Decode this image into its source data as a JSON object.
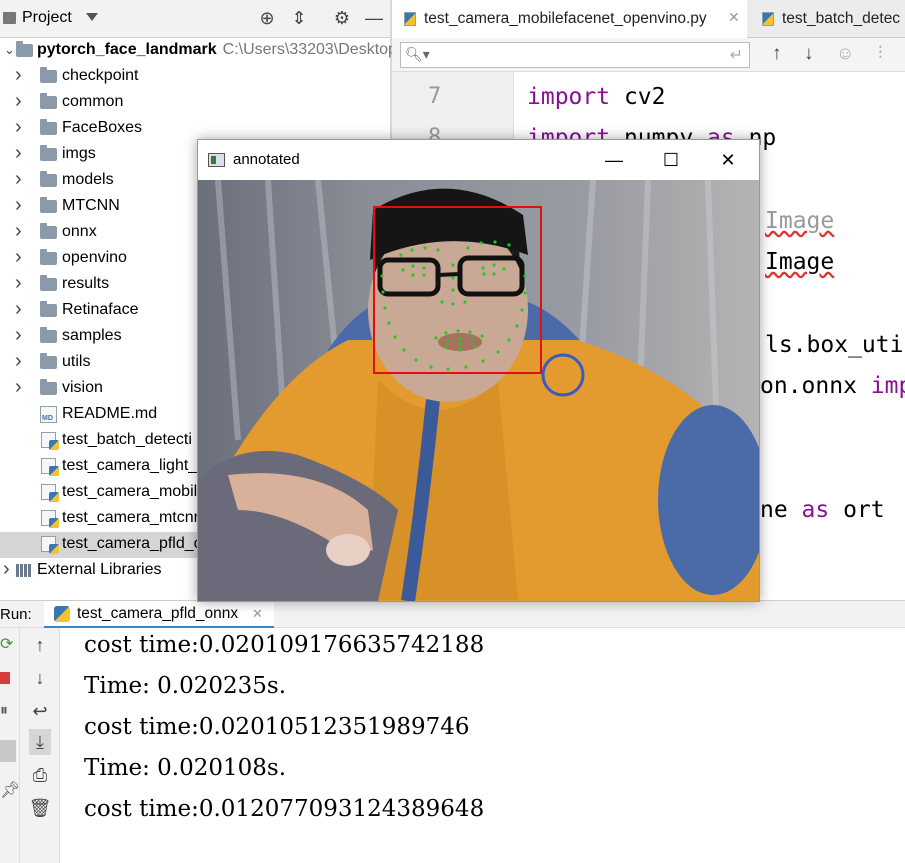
{
  "project": {
    "title": "Project",
    "root_name": "pytorch_face_landmark",
    "root_path": "C:\\Users\\33203\\Desktop",
    "items": [
      {
        "label": "checkpoint",
        "type": "folder"
      },
      {
        "label": "common",
        "type": "folder"
      },
      {
        "label": "FaceBoxes",
        "type": "folder"
      },
      {
        "label": "imgs",
        "type": "folder"
      },
      {
        "label": "models",
        "type": "folder"
      },
      {
        "label": "MTCNN",
        "type": "folder"
      },
      {
        "label": "onnx",
        "type": "folder"
      },
      {
        "label": "openvino",
        "type": "folder"
      },
      {
        "label": "results",
        "type": "folder"
      },
      {
        "label": "Retinaface",
        "type": "folder"
      },
      {
        "label": "samples",
        "type": "folder"
      },
      {
        "label": "utils",
        "type": "folder"
      },
      {
        "label": "vision",
        "type": "folder"
      },
      {
        "label": "README.md",
        "type": "md"
      },
      {
        "label": "test_batch_detecti",
        "type": "py"
      },
      {
        "label": "test_camera_light_",
        "type": "py"
      },
      {
        "label": "test_camera_mobil",
        "type": "py"
      },
      {
        "label": "test_camera_mtcnr",
        "type": "py"
      },
      {
        "label": "test_camera_pfld_c",
        "type": "py",
        "selected": true
      }
    ],
    "external_libraries": "External Libraries",
    "md_badge": "MD"
  },
  "editor": {
    "tabs": [
      {
        "label": "test_camera_mobilefacenet_openvino.py",
        "active": true
      },
      {
        "label": "test_batch_detec",
        "active": false
      }
    ],
    "line_numbers": [
      "7",
      "8"
    ],
    "code": {
      "l7_kw": "import",
      "l7_rest": " cv2",
      "l8_kw": "import",
      "l8_mid": " numpy ",
      "l8_kw2": "as",
      "l8_rest": " np",
      "l_image1": "Image",
      "l_image2": "Image",
      "l_box": "ls.box_uti",
      "l_onnx": "on.onnx ",
      "l_onnx_kw": "imp",
      "l_ort_pre": "ne ",
      "l_ort_kw": "as",
      "l_ort_rest": " ort"
    }
  },
  "window": {
    "title": "annotated",
    "minimize": "—",
    "maximize": "☐",
    "close": "✕"
  },
  "run": {
    "label": "Run:",
    "tab_label": "test_camera_pfld_onnx",
    "console_lines": [
      "cost time:0.020109176635742188",
      "Time: 0.020235s.",
      "cost time:0.02010512351989746",
      "Time: 0.020108s.",
      "cost time:0.012077093124389648"
    ]
  },
  "colors": {
    "keyword": "#871094",
    "bbox": "#e01010",
    "landmark": "#22cc22",
    "jacket": "#e39a2e",
    "selection": "#d5d5d5"
  }
}
